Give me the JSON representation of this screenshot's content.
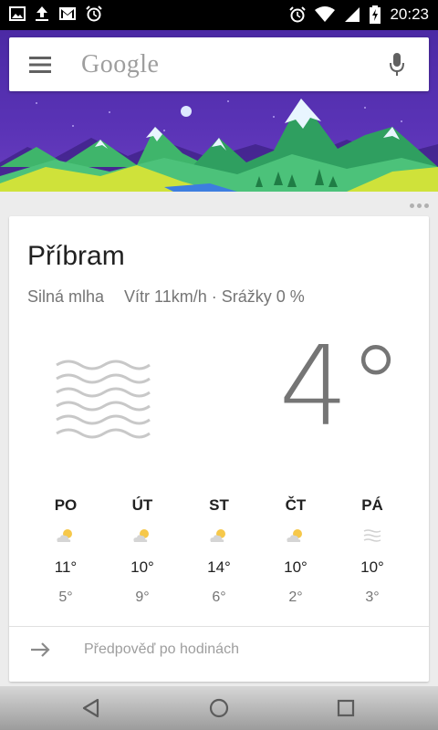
{
  "status_bar": {
    "left_icons": [
      "image-icon",
      "upload-icon",
      "gmail-icon",
      "alarm-icon"
    ],
    "right_icons": [
      "alarm-icon",
      "wifi-icon",
      "signal-icon",
      "battery-charging-icon"
    ],
    "time": "20:23"
  },
  "search": {
    "logo_text": "Google"
  },
  "weather": {
    "city": "Příbram",
    "condition": "Silná mlha",
    "details": "Vítr 11km/h · Srážky 0 %",
    "temperature": "4°",
    "forecast": [
      {
        "day": "PO",
        "icon": "partly-cloudy-icon",
        "high": "11°",
        "low": "5°"
      },
      {
        "day": "ÚT",
        "icon": "partly-cloudy-icon",
        "high": "10°",
        "low": "9°"
      },
      {
        "day": "ST",
        "icon": "partly-cloudy-icon",
        "high": "14°",
        "low": "6°"
      },
      {
        "day": "ČT",
        "icon": "partly-cloudy-icon",
        "high": "10°",
        "low": "2°"
      },
      {
        "day": "PÁ",
        "icon": "fog-icon",
        "high": "10°",
        "low": "3°"
      }
    ],
    "hourly_link": "Předpověď po hodinách"
  },
  "colors": {
    "header_sky": "#4b2aa4",
    "mountain_green": "#3fb56b",
    "ground_yellow": "#cfe23a"
  }
}
